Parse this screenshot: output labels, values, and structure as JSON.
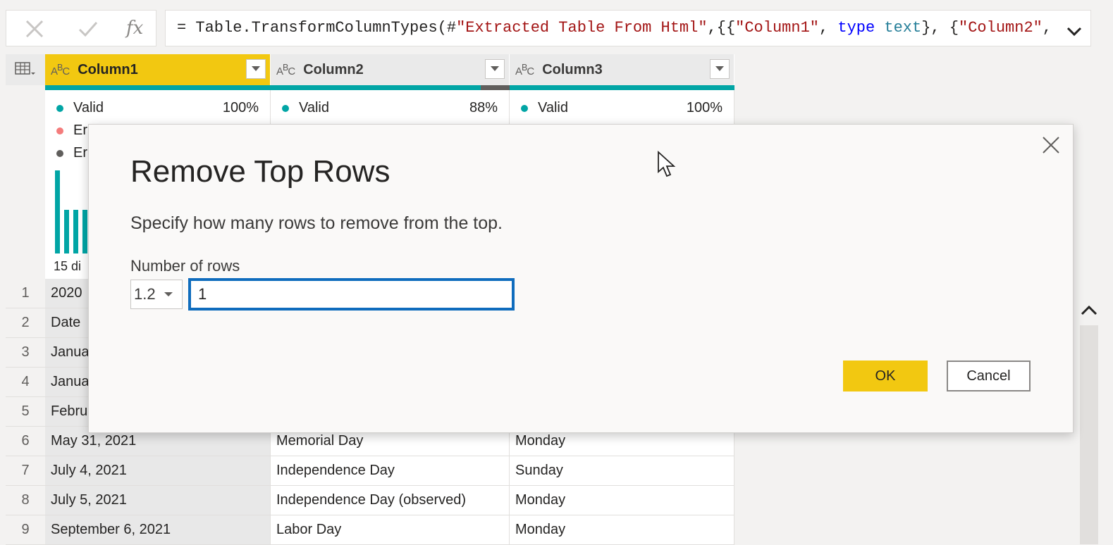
{
  "formula_bar": {
    "prefix": "= Table.TransformColumnTypes(#",
    "str1": "\"Extracted Table From Html\"",
    "mid1": ",{{",
    "str2": "\"Column1\"",
    "mid2": ", ",
    "kw": "type",
    "mid3": " ",
    "ty": "text",
    "mid4": "}, {",
    "str3": "\"Column2\"",
    "tail": ",",
    "fx_label": "fx"
  },
  "columns": [
    {
      "type_icon": "ABC",
      "name": "Column1",
      "valid_label": "Valid",
      "valid_pct": "100%",
      "error_label": "Er",
      "empty_label": "Er",
      "distinct": "15 di"
    },
    {
      "type_icon": "ABC",
      "name": "Column2",
      "valid_label": "Valid",
      "valid_pct": "88%"
    },
    {
      "type_icon": "ABC",
      "name": "Column3",
      "valid_label": "Valid",
      "valid_pct": "100%"
    }
  ],
  "rows": [
    {
      "n": "1",
      "c1": "2020",
      "c2": "",
      "c3": ""
    },
    {
      "n": "2",
      "c1": "Date",
      "c2": "",
      "c3": ""
    },
    {
      "n": "3",
      "c1": "Janua",
      "c2": "",
      "c3": ""
    },
    {
      "n": "4",
      "c1": "Janua",
      "c2": "",
      "c3": ""
    },
    {
      "n": "5",
      "c1": "Febru",
      "c2": "",
      "c3": ""
    },
    {
      "n": "6",
      "c1": "May 31, 2021",
      "c2": "Memorial Day",
      "c3": "Monday"
    },
    {
      "n": "7",
      "c1": "July 4, 2021",
      "c2": "Independence Day",
      "c3": "Sunday"
    },
    {
      "n": "8",
      "c1": "July 5, 2021",
      "c2": "Independence Day (observed)",
      "c3": "Monday"
    },
    {
      "n": "9",
      "c1": "September 6, 2021",
      "c2": "Labor Day",
      "c3": "Monday"
    }
  ],
  "dialog": {
    "title": "Remove Top Rows",
    "description": "Specify how many rows to remove from the top.",
    "field_label": "Number of rows",
    "type_value": "1.2",
    "rows_value": "1",
    "ok_label": "OK",
    "cancel_label": "Cancel"
  },
  "colors": {
    "accent": "#f2c811",
    "valid": "#01a5a5",
    "error": "#f47c7c",
    "empty": "#605e5c",
    "focus": "#0f6cbd"
  },
  "icons": [
    "cancel-x-icon",
    "commit-check-icon",
    "table-menu-icon",
    "chevron-down-icon",
    "close-icon",
    "scroll-up-icon",
    "mouse-cursor-icon"
  ]
}
